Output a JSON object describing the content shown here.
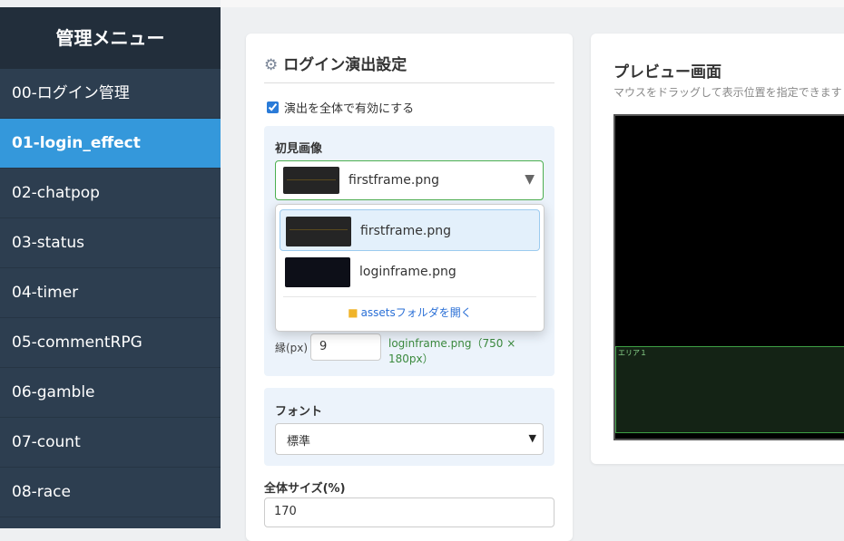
{
  "sidebar": {
    "title": "管理メニュー",
    "items": [
      {
        "label": "00-ログイン管理"
      },
      {
        "label": "01-login_effect"
      },
      {
        "label": "02-chatpop"
      },
      {
        "label": "03-status"
      },
      {
        "label": "04-timer"
      },
      {
        "label": "05-commentRPG"
      },
      {
        "label": "06-gamble"
      },
      {
        "label": "07-count"
      },
      {
        "label": "08-race"
      }
    ],
    "active_index": 1
  },
  "settings": {
    "title": "ログイン演出設定",
    "enable_label": "演出を全体で有効にする",
    "enable_checked": true,
    "first_image": {
      "label": "初見画像",
      "selected": "firstframe.png"
    },
    "margin": {
      "label": "縁(px)",
      "value": "9",
      "info": "loginframe.png（750 × 180px）"
    },
    "font": {
      "label": "フォント",
      "selected": "標準"
    },
    "overall_size": {
      "label": "全体サイズ(%)",
      "value": "170"
    }
  },
  "dropdown": {
    "options": [
      {
        "file": "firstframe.png",
        "selected": true
      },
      {
        "file": "loginframe.png",
        "selected": false
      }
    ],
    "open_assets_label": "assetsフォルダを開く"
  },
  "preview": {
    "title": "プレビュー画面",
    "hint": "マウスをドラッグして表示位置を指定できます",
    "area_label": "エリア１"
  },
  "colors": {
    "sidebar_bg": "#2d3e50",
    "active_accent": "#3498db",
    "select_border": "#4caf50",
    "link": "#2a6fd6"
  }
}
